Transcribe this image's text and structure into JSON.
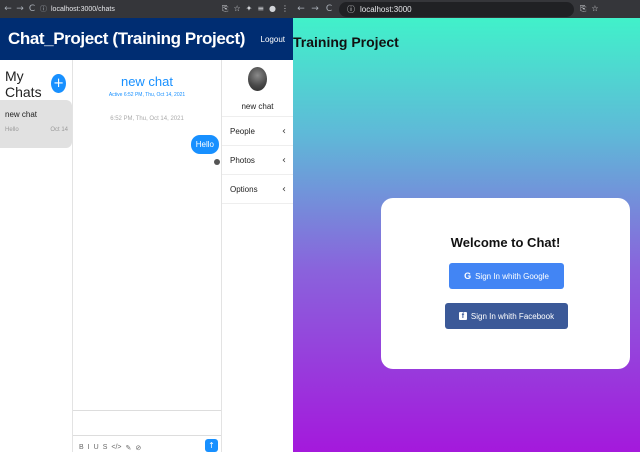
{
  "left_browser": {
    "url": "localhost:3000/chats",
    "nav": {
      "back": "←",
      "forward": "→",
      "reload": "C"
    },
    "icons": [
      "translate-icon",
      "star-icon",
      "puzzle-icon",
      "menu-icon",
      "profile-icon",
      "more-icon"
    ]
  },
  "app": {
    "title": "Chat_Project (Training Project)",
    "logout": "Logout"
  },
  "chat_list": {
    "title": "My Chats",
    "new_button": "+",
    "items": [
      {
        "name": "new chat",
        "preview": "Hello",
        "date": "Oct 14"
      }
    ]
  },
  "feed": {
    "title": "new chat",
    "subtitle": "Active 6:52 PM, Thu, Oct 14, 2021",
    "timestamp": "6:52 PM, Thu, Oct 14, 2021",
    "messages": [
      {
        "text": "Hello"
      }
    ],
    "toolbar": [
      "B",
      "I",
      "U",
      "S",
      "</>",
      "✎",
      "⊘"
    ],
    "send": "↑"
  },
  "settings": {
    "chat_name": "new chat",
    "items": [
      {
        "label": "People",
        "chevron": "‹"
      },
      {
        "label": "Photos",
        "chevron": "‹"
      },
      {
        "label": "Options",
        "chevron": "‹"
      }
    ]
  },
  "right_browser": {
    "url": "localhost:3000",
    "nav": {
      "back": "←",
      "forward": "→",
      "reload": "C"
    }
  },
  "login": {
    "brand": "Training Project",
    "welcome": "Welcome to Chat!",
    "google_label": "Sign In whith Google",
    "google_icon": "G",
    "facebook_label": "Sign In whith Facebook",
    "facebook_icon": "f"
  },
  "colors": {
    "header": "#002d72",
    "accent": "#1890ff",
    "google": "#4285f4",
    "facebook": "#3b5998",
    "gradient_top": "#3cfac8",
    "gradient_bottom": "#a419dc"
  }
}
